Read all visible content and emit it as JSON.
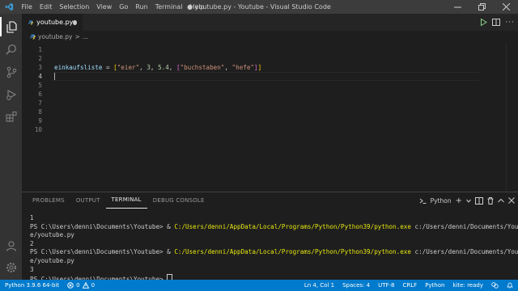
{
  "titlebar": {
    "menu": [
      "File",
      "Edit",
      "Selection",
      "View",
      "Go",
      "Run",
      "Terminal",
      "Help"
    ],
    "window_title": "● youtube.py - Youtube - Visual Studio Code"
  },
  "tab": {
    "label": "youtube.py"
  },
  "breadcrumb": {
    "file": "youtube.py",
    "sep": ">",
    "rest": "..."
  },
  "editor": {
    "line_numbers": [
      "1",
      "2",
      "3",
      "4",
      "5",
      "6",
      "7",
      "8",
      "9",
      "10"
    ],
    "code_line3": {
      "var": "einkaufsliste",
      "op": " = ",
      "open": "[",
      "s1": "\"eier\"",
      "c1": ", ",
      "n1": "3",
      "c2": ", ",
      "n2": "5.4",
      "c3": ", ",
      "open2": "[",
      "s2": "\"buchstaben\"",
      "c4": ", ",
      "s3": "\"hefe\"",
      "close2": "]",
      "close": "]"
    }
  },
  "panel": {
    "tabs": [
      "PROBLEMS",
      "OUTPUT",
      "TERMINAL",
      "DEBUG CONSOLE"
    ],
    "terminal_selector": "Python",
    "terminal": {
      "l1": "1",
      "l2_prompt": "PS C:\\Users\\denni\\Documents\\Youtube> & ",
      "l2_path": "C:/Users/denni/AppData/Local/Programs/Python/Python39/python.exe",
      "l2_arg": " c:/Users/denni/Documents/Youtub",
      "l3": "e/youtube.py",
      "l4": "2",
      "l5_prompt": "PS C:\\Users\\denni\\Documents\\Youtube> & ",
      "l5_path": "C:/Users/denni/AppData/Local/Programs/Python/Python39/python.exe",
      "l5_arg": " c:/Users/denni/Documents/Youtub",
      "l6": "e/youtube.py",
      "l7": "3",
      "l8": "PS C:\\Users\\denni\\Documents\\Youtube> "
    }
  },
  "statusbar": {
    "interpreter": "Python 3.9.6 64-bit",
    "errors": "0",
    "warnings": "0",
    "position": "Ln 4, Col 1",
    "spaces": "Spaces: 4",
    "encoding": "UTF-8",
    "eol": "CRLF",
    "language": "Python",
    "kite": "kite: ready"
  },
  "colors": {
    "accent": "#007acc",
    "titlebar": "#3c3c3c",
    "activitybar": "#333333",
    "editor_bg": "#1e1e1e"
  }
}
